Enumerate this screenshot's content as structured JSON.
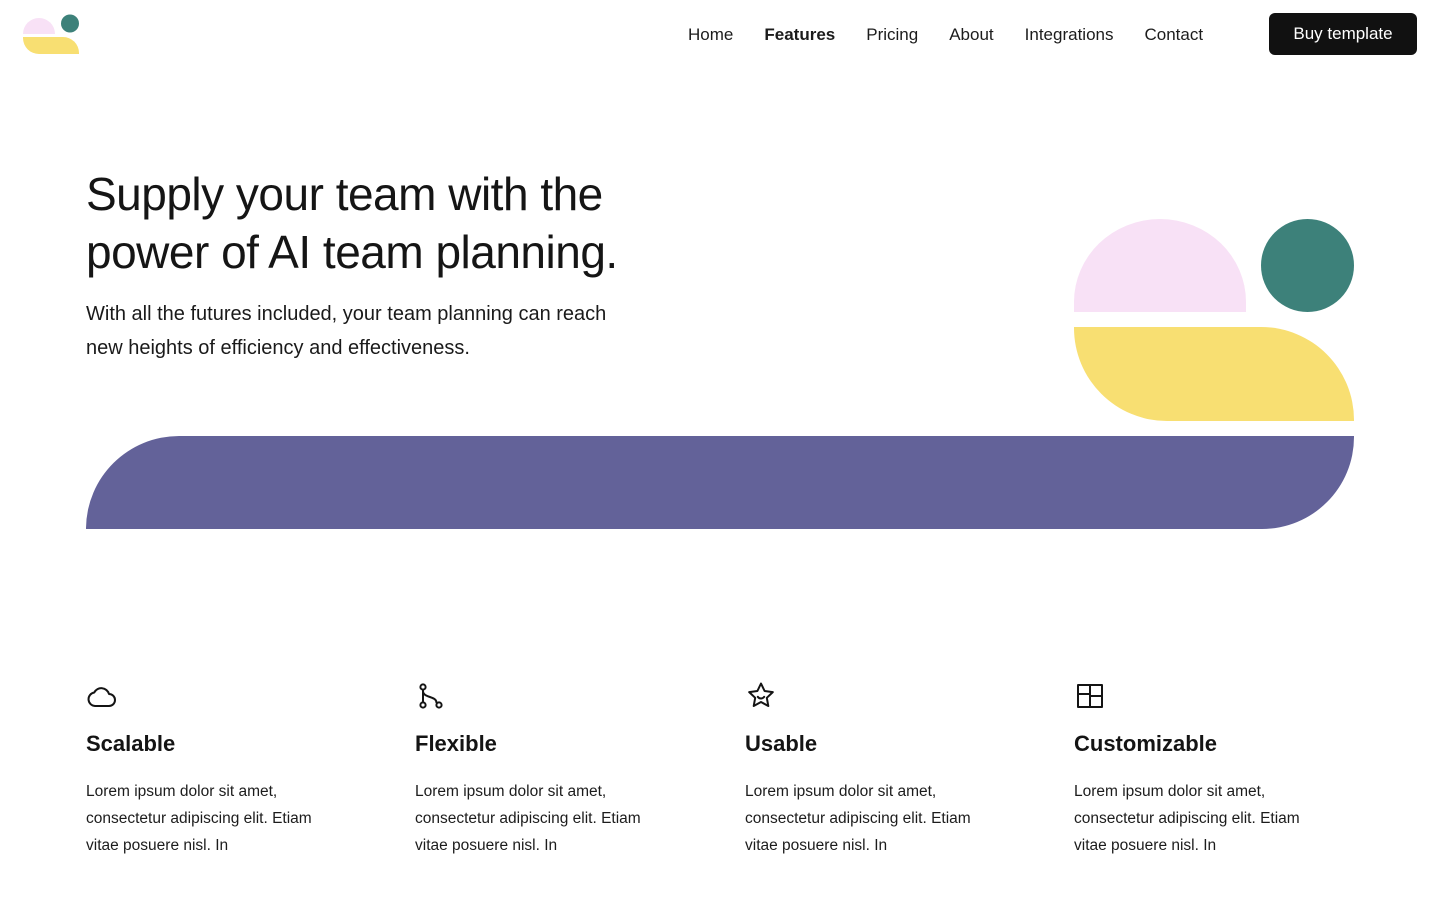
{
  "brand": {
    "logo_icon": "brand-shapes-logo",
    "colors": {
      "pink": "#f8e1f6",
      "teal": "#3d817a",
      "yellow": "#f8df72",
      "purple": "#636299",
      "dark": "#111111"
    }
  },
  "nav": {
    "items": [
      {
        "label": "Home",
        "active": false
      },
      {
        "label": "Features",
        "active": true
      },
      {
        "label": "Pricing",
        "active": false
      },
      {
        "label": "About",
        "active": false
      },
      {
        "label": "Integrations",
        "active": false
      },
      {
        "label": "Contact",
        "active": false
      }
    ],
    "cta_label": "Buy template"
  },
  "hero": {
    "title_line1": "Supply your team with the",
    "title_line2": "power of AI team planning.",
    "subtitle_line1": "With all the futures included, your team planning can reach",
    "subtitle_line2": "new heights of efficiency and effectiveness."
  },
  "features": [
    {
      "icon": "cloud-icon",
      "title": "Scalable",
      "desc_line1": "Lorem ipsum dolor sit amet,",
      "desc_line2": "consectetur adipiscing elit. Etiam",
      "desc_line3": "vitae posuere nisl. In"
    },
    {
      "icon": "git-branch-icon",
      "title": "Flexible",
      "desc_line1": "Lorem ipsum dolor sit amet,",
      "desc_line2": "consectetur adipiscing elit. Etiam",
      "desc_line3": "vitae posuere nisl. In"
    },
    {
      "icon": "star-smile-icon",
      "title": "Usable",
      "desc_line1": "Lorem ipsum dolor sit amet,",
      "desc_line2": "consectetur adipiscing elit. Etiam",
      "desc_line3": "vitae posuere nisl. In"
    },
    {
      "icon": "layout-grid-icon",
      "title": "Customizable",
      "desc_line1": "Lorem ipsum dolor sit amet,",
      "desc_line2": "consectetur adipiscing elit. Etiam",
      "desc_line3": "vitae posuere nisl. In"
    }
  ]
}
